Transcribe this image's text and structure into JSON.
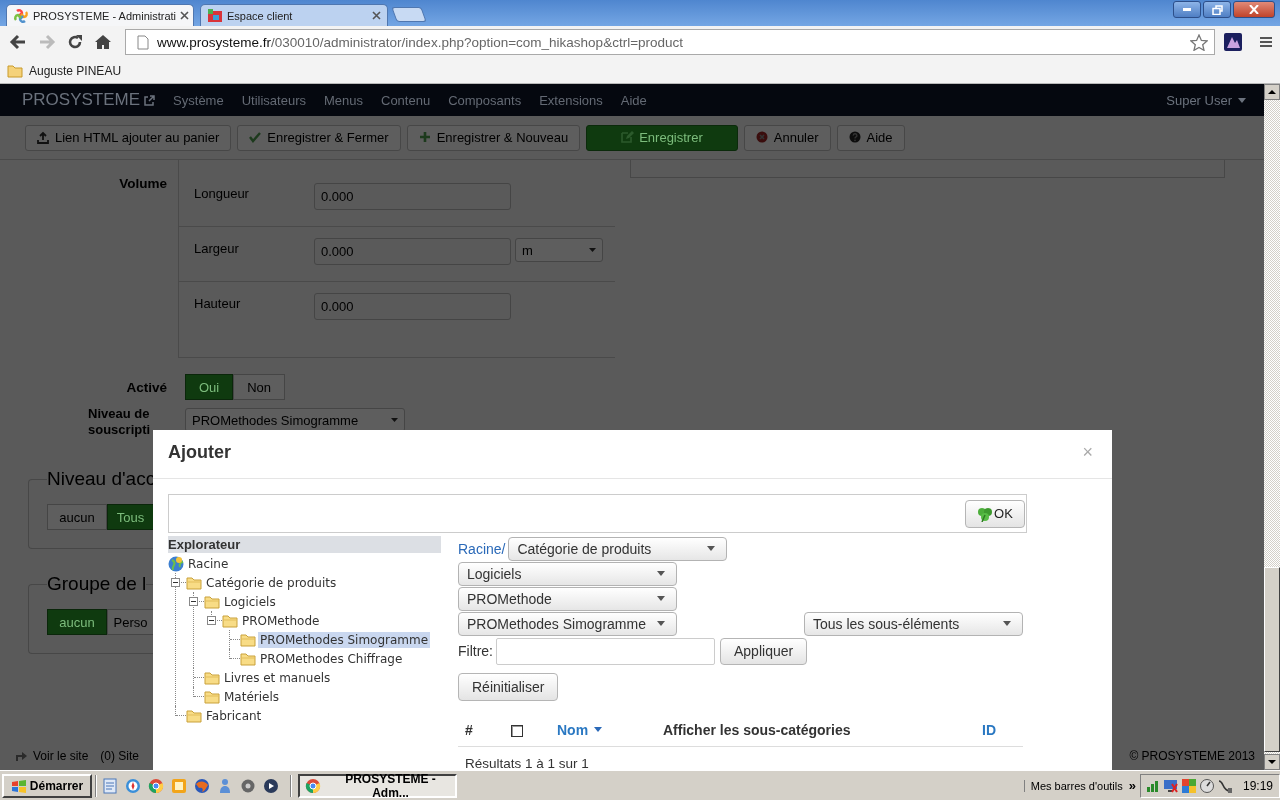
{
  "browser": {
    "tabs": [
      {
        "title": "PROSYSTEME - Administrati",
        "selected": true
      },
      {
        "title": "Espace client",
        "selected": false
      }
    ],
    "address": {
      "host": "www.prosysteme.fr",
      "path": "/030010/administrator/index.php?option=com_hikashop&ctrl=product"
    },
    "bookmarks": [
      "Auguste PINEAU"
    ]
  },
  "admin": {
    "brand": "PROSYSTEME",
    "menu": [
      "Système",
      "Utilisateurs",
      "Menus",
      "Contenu",
      "Composants",
      "Extensions",
      "Aide"
    ],
    "user": "Super User",
    "toolbar": [
      {
        "label": "Lien HTML ajouter au panier",
        "kind": "upload",
        "primary": false
      },
      {
        "label": "Enregistrer & Fermer",
        "kind": "check",
        "primary": false
      },
      {
        "label": "Enregistrer & Nouveau",
        "kind": "plus",
        "primary": false
      },
      {
        "label": "Enregistrer",
        "kind": "edit",
        "primary": true
      },
      {
        "label": "Annuler",
        "kind": "cancel",
        "primary": false
      },
      {
        "label": "Aide",
        "kind": "help",
        "primary": false
      }
    ]
  },
  "form": {
    "volume": {
      "label": "Volume",
      "rows": [
        {
          "label": "Longueur",
          "value": "0.000"
        },
        {
          "label": "Largeur",
          "value": "0.000",
          "unit": "m"
        },
        {
          "label": "Hauteur",
          "value": "0.000"
        }
      ]
    },
    "active": {
      "label": "Activé",
      "options": [
        {
          "label": "Oui",
          "selected": true
        },
        {
          "label": "Non",
          "selected": false
        }
      ]
    },
    "subscription": {
      "label": "Niveau de souscripti",
      "value": "PROMethodes Simogramme"
    },
    "access": {
      "legend": "Niveau d'acc",
      "options": [
        {
          "label": "aucun",
          "selected": false
        },
        {
          "label": "Tous",
          "selected": true
        }
      ]
    },
    "group": {
      "legend": "Groupe de l",
      "options": [
        {
          "label": "aucun",
          "selected": true
        },
        {
          "label": "Perso",
          "selected": false
        }
      ]
    }
  },
  "footer": {
    "links": [
      "Voir le site",
      "(0) Site"
    ],
    "copyright": "© PROSYSTEME 2013"
  },
  "modal": {
    "title": "Ajouter",
    "close": "×",
    "ok": "OK",
    "explorer": {
      "title": "Explorateur",
      "tree": [
        {
          "label": "Racine",
          "kind": "root",
          "selected": false,
          "children": [
            {
              "label": "Catégorie de produits",
              "selected": false,
              "expanded": true,
              "children": [
                {
                  "label": "Logiciels",
                  "selected": false,
                  "expanded": true,
                  "children": [
                    {
                      "label": "PROMethode",
                      "selected": false,
                      "expanded": true,
                      "children": [
                        {
                          "label": "PROMethodes Simogramme",
                          "selected": true
                        },
                        {
                          "label": "PROMethodes Chiffrage",
                          "selected": false
                        }
                      ]
                    }
                  ]
                },
                {
                  "label": "Livres et manuels",
                  "selected": false
                },
                {
                  "label": "Matériels",
                  "selected": false
                }
              ]
            },
            {
              "label": "Fabricant",
              "selected": false
            }
          ]
        }
      ]
    },
    "breadcrumb": {
      "root": "Racine/",
      "levels": [
        "Catégorie de produits",
        "Logiciels",
        "PROMethode",
        "PROMethodes Simogramme"
      ]
    },
    "scope": "Tous les sous-éléments",
    "filter": {
      "label": "Filtre:"
    },
    "apply": "Appliquer",
    "reset": "Réinitialiser",
    "table": {
      "columns": [
        {
          "label": "#",
          "kind": "text"
        },
        {
          "kind": "checkbox",
          "checked": false
        },
        {
          "label": "Nom",
          "kind": "sort"
        },
        {
          "label": "Afficher les sous-catégories",
          "kind": "text"
        },
        {
          "label": "ID",
          "kind": "link"
        }
      ]
    },
    "results": "Résultats 1 à 1 sur 1"
  },
  "taskbar": {
    "start": "Démarrer",
    "tasks": [
      {
        "label": "PROSYSTEME - Adm...",
        "selected": true
      }
    ],
    "toolbars": "Mes barres d'outils",
    "chevron": "»",
    "clock": "19:19"
  }
}
